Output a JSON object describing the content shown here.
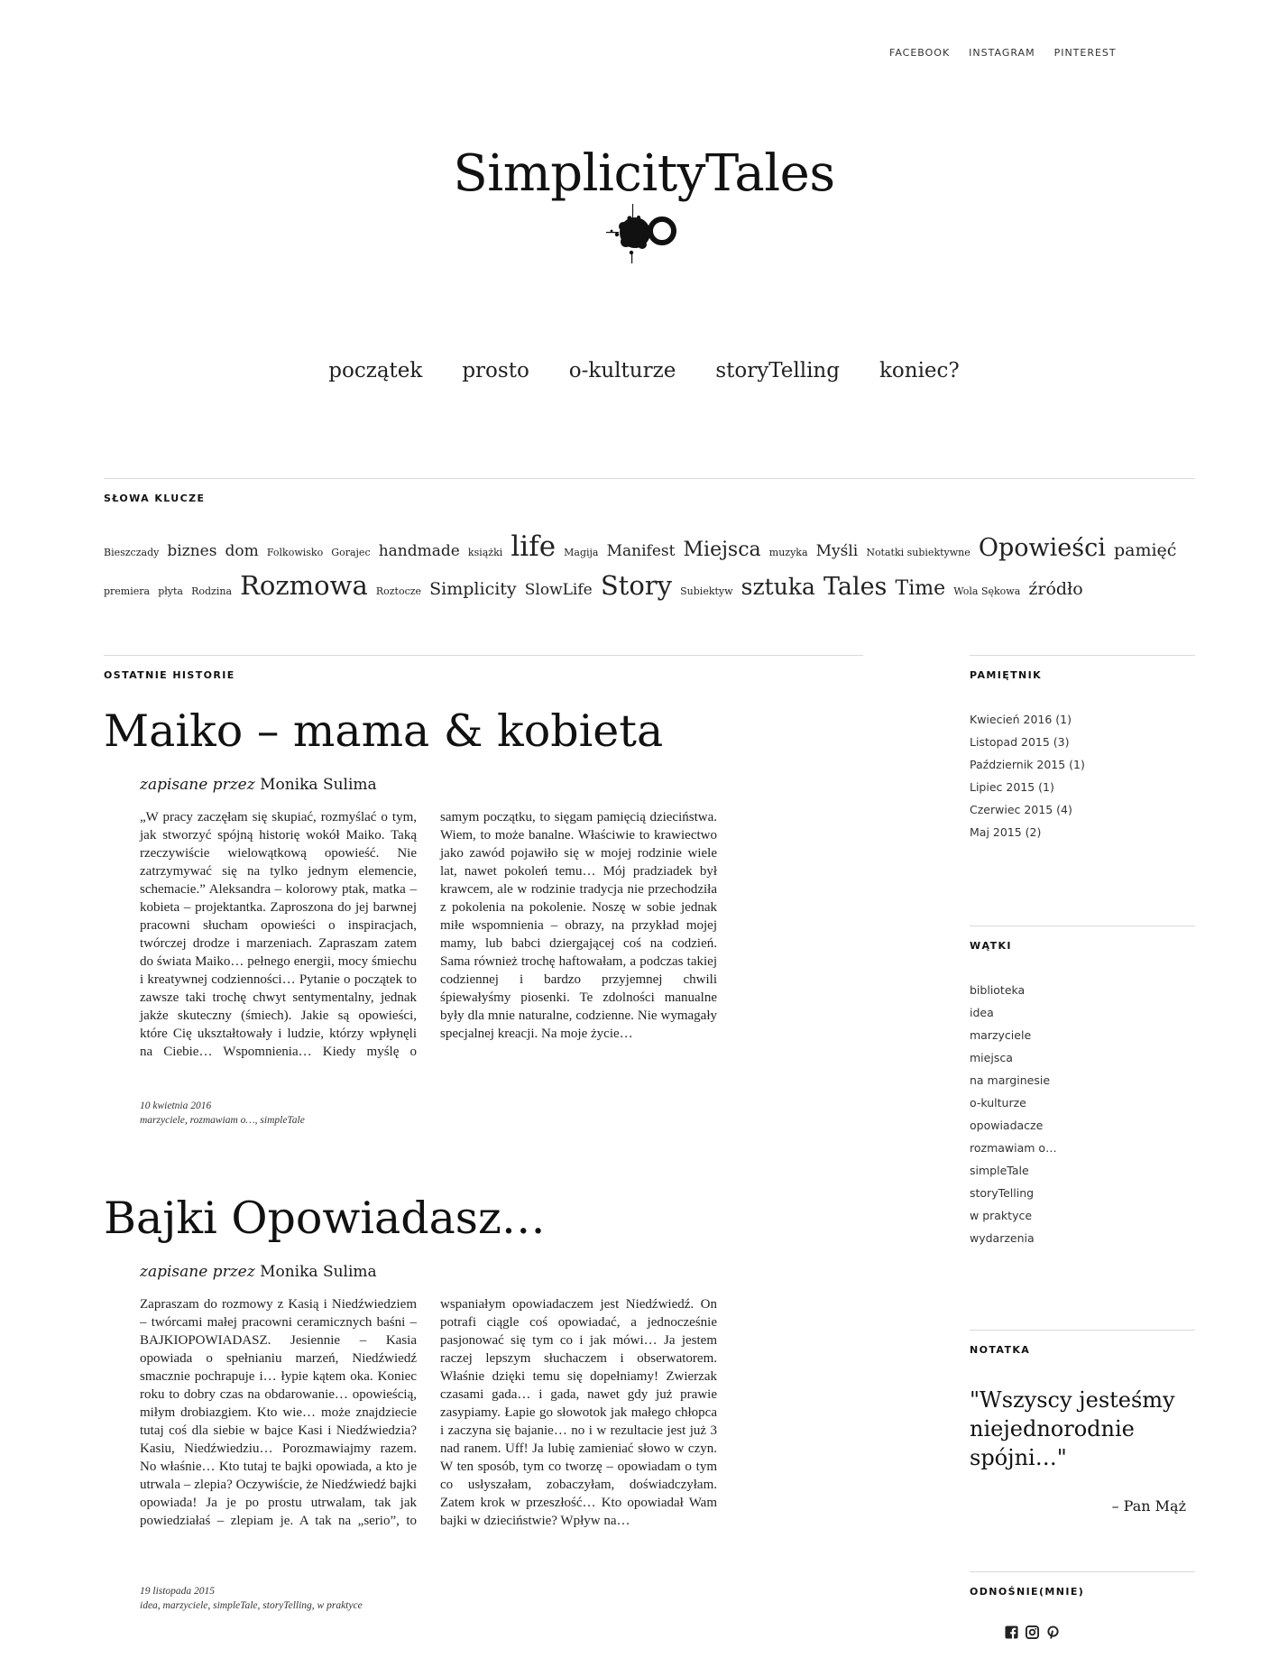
{
  "top_links": [
    "FACEBOOK",
    "INSTAGRAM",
    "PINTEREST"
  ],
  "site": {
    "title": "SimplicityTales"
  },
  "menu": [
    "początek",
    "prosto",
    "o-kulturze",
    "storyTelling",
    "koniec?"
  ],
  "tags": {
    "title": "SŁOWA KLUCZE",
    "items": [
      {
        "label": "Bieszczady",
        "size": 11
      },
      {
        "label": "biznes",
        "size": 17
      },
      {
        "label": "dom",
        "size": 17
      },
      {
        "label": "Folkowisko",
        "size": 11
      },
      {
        "label": "Gorajec",
        "size": 11
      },
      {
        "label": "handmade",
        "size": 17
      },
      {
        "label": "książki",
        "size": 11
      },
      {
        "label": "life",
        "size": 31
      },
      {
        "label": "Magija",
        "size": 11
      },
      {
        "label": "Manifest",
        "size": 17
      },
      {
        "label": "Miejsca",
        "size": 22
      },
      {
        "label": "muzyka",
        "size": 11
      },
      {
        "label": "Myśli",
        "size": 17
      },
      {
        "label": "Notatki subiektywne",
        "size": 11
      },
      {
        "label": "Opowieści",
        "size": 27
      },
      {
        "label": "pamięć",
        "size": 19
      },
      {
        "label": "premiera",
        "size": 11
      },
      {
        "label": "płyta",
        "size": 11
      },
      {
        "label": "Rodzina",
        "size": 11
      },
      {
        "label": "Rozmowa",
        "size": 29
      },
      {
        "label": "Roztocze",
        "size": 11
      },
      {
        "label": "Simplicity",
        "size": 19
      },
      {
        "label": "SlowLife",
        "size": 17
      },
      {
        "label": "Story",
        "size": 29
      },
      {
        "label": "Subiektyw",
        "size": 11
      },
      {
        "label": "sztuka",
        "size": 25
      },
      {
        "label": "Tales",
        "size": 27
      },
      {
        "label": "Time",
        "size": 22
      },
      {
        "label": "Wola Sękowa",
        "size": 11
      },
      {
        "label": "źródło",
        "size": 19
      }
    ]
  },
  "recent": {
    "title": "OSTATNIE HISTORIE",
    "posts": [
      {
        "title": "Maiko – mama & kobieta",
        "by_label": "zapisane przez",
        "author": "Monika Sulima",
        "excerpt": "„W pracy zaczęłam się skupiać, rozmyślać o tym, jak stworzyć spójną historię wokół Maiko. Taką rzeczywiście wielowątkową opowieść. Nie zatrzymywać się na tylko jednym elemencie, schemacie.” Aleksandra – kolorowy ptak, matka – kobieta – projektantka. Zaproszona do jej barwnej pracowni słucham opowieści o inspiracjach, twórczej drodze i marzeniach. Zapraszam zatem do świata Maiko… pełnego energii, mocy śmiechu i kreatywnej codzienności… Pytanie o początek to zawsze taki trochę chwyt sentymentalny, jednak jakże skuteczny (śmiech). Jakie są opowieści, które Cię ukształtowały i ludzie, którzy wpłynęli na Ciebie… Wspomnienia… Kiedy myślę o samym początku, to sięgam pamięcią dzieciństwa. Wiem, to może banalne. Właściwie to krawiectwo jako zawód pojawiło się w mojej rodzinie wiele lat, nawet pokoleń temu… Mój pradziadek był krawcem, ale w rodzinie tradycja nie przechodziła z pokolenia na pokolenie. Noszę w sobie jednak miłe wspomnienia – obrazy, na przykład mojej mamy, lub babci dziergającej coś na codzień. Sama również trochę haftowałam, a podczas takiej codziennej i bardzo przyjemnej chwili śpiewałyśmy piosenki. Te zdolności manualne były dla mnie naturalne, codzienne. Nie wymagały specjalnej kreacji. Na moje życie…",
        "date": "10 kwietnia 2016",
        "categories": "marzyciele, rozmawiam o…, simpleTale"
      },
      {
        "title": "Bajki Opowiadasz…",
        "by_label": "zapisane przez",
        "author": "Monika Sulima",
        "excerpt": "Zapraszam do rozmowy z Kasią i Niedźwiedziem – twórcami małej pracowni ceramicznych baśni – BAJKIOPOWIADASZ.  Jesiennie –  Kasia opowiada o spełnianiu marzeń, Niedźwiedź smacznie pochrapuje i… łypie kątem oka. Koniec roku to dobry czas na obdarowanie… opowieścią, miłym drobiazgiem. Kto wie… może znajdziecie tutaj coś dla siebie w bajce Kasi i Niedźwiedzia? Kasiu, Niedźwiedziu… Porozmawiajmy razem. No właśnie… Kto tutaj te bajki opowiada, a kto je utrwala – zlepia? Oczywiście, że Niedźwiedź bajki opowiada! Ja je po prostu utrwalam, tak jak powiedziałaś – zlepiam je. A tak na „serio”, to wspaniałym opowiadaczem jest Niedźwiedź. On potrafi ciągle coś opowiadać, a jednocześnie pasjonować się tym co i jak mówi… Ja jestem raczej lepszym słuchaczem i obserwatorem. Właśnie dzięki temu się dopełniamy!  Zwierzak czasami gada… i gada, nawet gdy już prawie zasypiamy. Łapie go słowotok jak małego chłopca i zaczyna się bajanie… no i w rezultacie jest już 3 nad ranem. Uff!  Ja lubię zamieniać słowo w czyn. W ten sposób, tym co tworzę –   opowiadam o tym co usłyszałam, zobaczyłam, doświadczyłam. Zatem krok w przeszłość… Kto opowiadał Wam  bajki w dzieciństwie? Wpływ na…",
        "date": "19 listopada 2015",
        "categories": "idea, marzyciele, simpleTale, storyTelling, w praktyce"
      }
    ]
  },
  "sidebar": {
    "archive": {
      "title": "PAMIĘTNIK",
      "items": [
        "Kwiecień 2016 (1)",
        "Listopad 2015 (3)",
        "Październik 2015 (1)",
        "Lipiec 2015 (1)",
        "Czerwiec 2015 (4)",
        "Maj 2015 (2)"
      ]
    },
    "categories": {
      "title": "WĄTKI",
      "items": [
        "biblioteka",
        "idea",
        "marzyciele",
        "miejsca",
        "na marginesie",
        "o-kulturze",
        "opowiadacze",
        "rozmawiam o…",
        "simpleTale",
        "storyTelling",
        "w praktyce",
        "wydarzenia"
      ]
    },
    "note": {
      "title": "NOTATKA",
      "quote": "\"Wszyscy jesteśmy niejednorodnie spójni…\"",
      "author": "–  Pan Mąż"
    },
    "links": {
      "title": "ODNOŚNIE(MNIE)",
      "icons": [
        "facebook-icon",
        "instagram-icon",
        "pinterest-icon"
      ]
    }
  }
}
